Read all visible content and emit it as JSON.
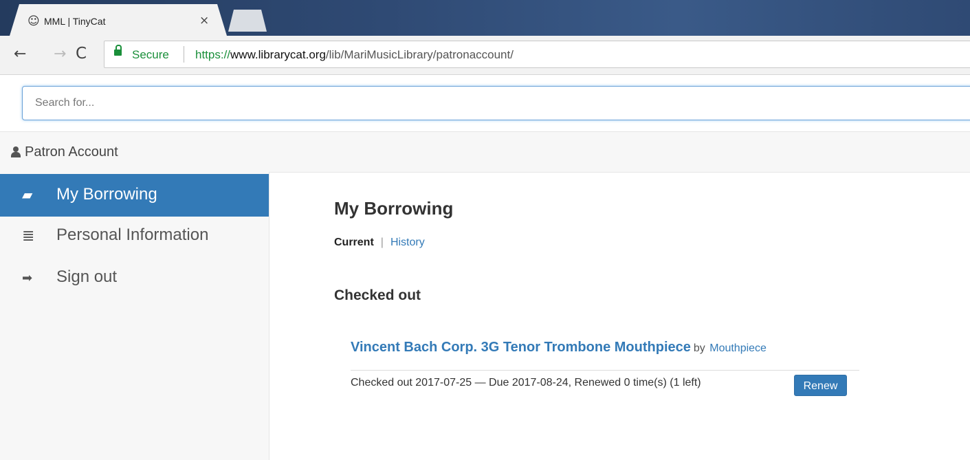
{
  "browser": {
    "tab_icon": "tinycat-icon",
    "tab_title": "MML | TinyCat",
    "tab_close": "×",
    "back": "←",
    "forward": "→",
    "reload": "C",
    "secure_label": "Secure",
    "url_scheme": "https://",
    "url_host": "www.librarycat.org",
    "url_path": "/lib/MariMusicLibrary/patronaccount/"
  },
  "search": {
    "placeholder": "Search for..."
  },
  "patron_header": {
    "label": "Patron Account"
  },
  "sidebar": {
    "items": [
      {
        "label": "My Borrowing",
        "icon": "book-icon",
        "glyph": "▰",
        "active": true
      },
      {
        "label": "Personal Information",
        "icon": "list-icon",
        "glyph": "≣",
        "active": false
      },
      {
        "label": "Sign out",
        "icon": "sign-out-icon",
        "glyph": "➡",
        "active": false
      }
    ]
  },
  "main": {
    "title": "My Borrowing",
    "tabs": {
      "current": "Current",
      "separator": "|",
      "history": "History"
    },
    "section_title": "Checked out",
    "item": {
      "title": "Vincent Bach Corp. 3G Tenor Trombone Mouthpiece",
      "by": "by",
      "author": "Mouthpiece",
      "status": "Checked out 2017-07-25 — Due 2017-08-24, Renewed 0 time(s) (1 left)",
      "renew_label": "Renew"
    }
  },
  "colors": {
    "accent": "#337ab7",
    "secure": "#1a8f3a"
  }
}
